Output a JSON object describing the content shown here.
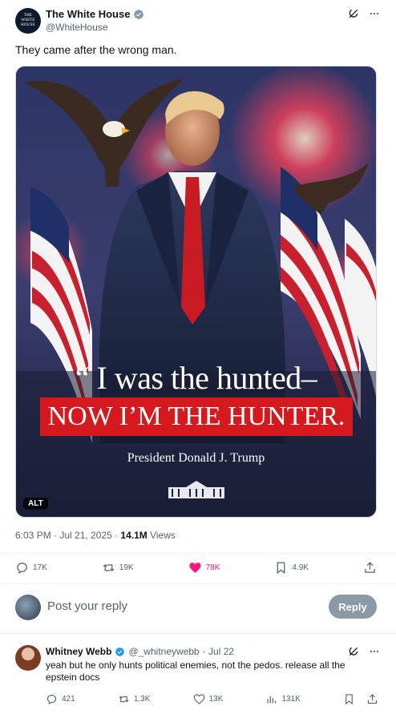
{
  "account": {
    "name": "The White House",
    "handle": "@WhiteHouse",
    "avatar_text": "THE WHITE HOUSE",
    "verified_color": "#829aab"
  },
  "tweet": {
    "text": "They came after the wrong man.",
    "timestamp": "6:03 PM · Jul 21, 2025 · ",
    "views_count": "14.1M",
    "views_label": " Views"
  },
  "media": {
    "quote_line1": "“ I was the hunted–",
    "quote_line2": "NOW I’M THE HUNTER.",
    "byline": "President Donald J. Trump",
    "alt_badge": "ALT",
    "banner_color": "#d41a1f"
  },
  "actions": {
    "replies": "17K",
    "reposts": "19K",
    "likes": "78K",
    "bookmarks": "4.9K",
    "like_color": "#f91880"
  },
  "reply_box": {
    "placeholder": "Post your reply",
    "button": "Reply"
  },
  "reply": {
    "name": "Whitney Webb",
    "handle": "@_whitneywebb",
    "date": "· Jul 22",
    "text": "yeah but he only hunts political enemies, not the pedos. release all the epstein docs",
    "replies": "421",
    "reposts": "1.3K",
    "likes": "13K",
    "views": "131K"
  }
}
